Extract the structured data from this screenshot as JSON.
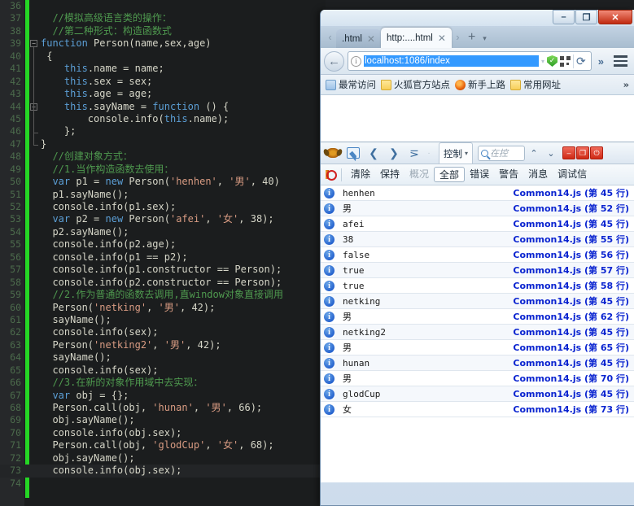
{
  "editor": {
    "first_line_number": 36,
    "lines": [
      {
        "n": 36,
        "segments": []
      },
      {
        "n": 37,
        "segments": [
          {
            "t": "  //模拟高级语言类的操作：",
            "c": "cmt"
          }
        ]
      },
      {
        "n": 38,
        "segments": [
          {
            "t": "  //第二种形式：构造函数式",
            "c": "cmt"
          }
        ]
      },
      {
        "n": 39,
        "fold": "minus",
        "segments": [
          {
            "t": "function",
            "c": "kw"
          },
          {
            "t": " Person(name,sex,age)",
            "c": ""
          }
        ]
      },
      {
        "n": 40,
        "segments": [
          {
            "t": " {",
            "c": ""
          }
        ]
      },
      {
        "n": 41,
        "segments": [
          {
            "t": "    ",
            "c": ""
          },
          {
            "t": "this",
            "c": "kw"
          },
          {
            "t": ".name = name;",
            "c": ""
          }
        ]
      },
      {
        "n": 42,
        "segments": [
          {
            "t": "    ",
            "c": ""
          },
          {
            "t": "this",
            "c": "kw"
          },
          {
            "t": ".sex = sex;",
            "c": ""
          }
        ]
      },
      {
        "n": 43,
        "segments": [
          {
            "t": "    ",
            "c": ""
          },
          {
            "t": "this",
            "c": "kw"
          },
          {
            "t": ".age = age;",
            "c": ""
          }
        ]
      },
      {
        "n": 44,
        "fold": "minus",
        "segments": [
          {
            "t": "    ",
            "c": ""
          },
          {
            "t": "this",
            "c": "kw"
          },
          {
            "t": ".sayName = ",
            "c": ""
          },
          {
            "t": "function",
            "c": "kw"
          },
          {
            "t": " () {",
            "c": ""
          }
        ]
      },
      {
        "n": 45,
        "segments": [
          {
            "t": "        console.info(",
            "c": ""
          },
          {
            "t": "this",
            "c": "kw"
          },
          {
            "t": ".name);",
            "c": ""
          }
        ]
      },
      {
        "n": 46,
        "segments": [
          {
            "t": "    };",
            "c": ""
          }
        ]
      },
      {
        "n": 47,
        "segments": [
          {
            "t": "}",
            "c": ""
          }
        ]
      },
      {
        "n": 48,
        "segments": [
          {
            "t": "  //创建对象方式：",
            "c": "cmt"
          }
        ]
      },
      {
        "n": 49,
        "segments": [
          {
            "t": "  //1.当作构造函数去使用：",
            "c": "cmt"
          }
        ]
      },
      {
        "n": 50,
        "segments": [
          {
            "t": "  ",
            "c": ""
          },
          {
            "t": "var",
            "c": "kw"
          },
          {
            "t": " p1 = ",
            "c": ""
          },
          {
            "t": "new",
            "c": "kw"
          },
          {
            "t": " Person(",
            "c": ""
          },
          {
            "t": "'henhen'",
            "c": "str"
          },
          {
            "t": ", ",
            "c": ""
          },
          {
            "t": "'男'",
            "c": "str"
          },
          {
            "t": ", 40)",
            "c": ""
          }
        ]
      },
      {
        "n": 51,
        "segments": [
          {
            "t": "  p1.sayName();",
            "c": ""
          }
        ]
      },
      {
        "n": 52,
        "segments": [
          {
            "t": "  console.info(p1.sex);",
            "c": ""
          }
        ]
      },
      {
        "n": 53,
        "segments": [
          {
            "t": "  ",
            "c": ""
          },
          {
            "t": "var",
            "c": "kw"
          },
          {
            "t": " p2 = ",
            "c": ""
          },
          {
            "t": "new",
            "c": "kw"
          },
          {
            "t": " Person(",
            "c": ""
          },
          {
            "t": "'afei'",
            "c": "str"
          },
          {
            "t": ", ",
            "c": ""
          },
          {
            "t": "'女'",
            "c": "str"
          },
          {
            "t": ", 38);",
            "c": ""
          }
        ]
      },
      {
        "n": 54,
        "segments": [
          {
            "t": "  p2.sayName();",
            "c": ""
          }
        ]
      },
      {
        "n": 55,
        "segments": [
          {
            "t": "  console.info(p2.age);",
            "c": ""
          }
        ]
      },
      {
        "n": 56,
        "segments": [
          {
            "t": "  console.info(p1 == p2);",
            "c": ""
          }
        ]
      },
      {
        "n": 57,
        "segments": [
          {
            "t": "  console.info(p1.constructor == Person);",
            "c": ""
          }
        ]
      },
      {
        "n": 58,
        "segments": [
          {
            "t": "  console.info(p2.constructor == Person);",
            "c": ""
          }
        ]
      },
      {
        "n": 59,
        "segments": [
          {
            "t": "  //2.作为普通的函数去调用,直window对象直接调用",
            "c": "cmt"
          }
        ]
      },
      {
        "n": 60,
        "segments": [
          {
            "t": "  Person(",
            "c": ""
          },
          {
            "t": "'netking'",
            "c": "str"
          },
          {
            "t": ", ",
            "c": ""
          },
          {
            "t": "'男'",
            "c": "str"
          },
          {
            "t": ", 42);",
            "c": ""
          }
        ]
      },
      {
        "n": 61,
        "segments": [
          {
            "t": "  sayName();",
            "c": ""
          }
        ]
      },
      {
        "n": 62,
        "segments": [
          {
            "t": "  console.info(sex);",
            "c": ""
          }
        ]
      },
      {
        "n": 63,
        "segments": [
          {
            "t": "  Person(",
            "c": ""
          },
          {
            "t": "'netking2'",
            "c": "str"
          },
          {
            "t": ", ",
            "c": ""
          },
          {
            "t": "'男'",
            "c": "str"
          },
          {
            "t": ", 42);",
            "c": ""
          }
        ]
      },
      {
        "n": 64,
        "segments": [
          {
            "t": "  sayName();",
            "c": ""
          }
        ]
      },
      {
        "n": 65,
        "segments": [
          {
            "t": "  console.info(sex);",
            "c": ""
          }
        ]
      },
      {
        "n": 66,
        "segments": [
          {
            "t": "  //3.在新的对象作用域中去实现：",
            "c": "cmt"
          }
        ]
      },
      {
        "n": 67,
        "segments": [
          {
            "t": "  ",
            "c": ""
          },
          {
            "t": "var",
            "c": "kw"
          },
          {
            "t": " obj = {};",
            "c": ""
          }
        ]
      },
      {
        "n": 68,
        "segments": [
          {
            "t": "  Person.call(obj, ",
            "c": ""
          },
          {
            "t": "'hunan'",
            "c": "str"
          },
          {
            "t": ", ",
            "c": ""
          },
          {
            "t": "'男'",
            "c": "str"
          },
          {
            "t": ", 66);",
            "c": ""
          }
        ]
      },
      {
        "n": 69,
        "segments": [
          {
            "t": "  obj.sayName();",
            "c": ""
          }
        ]
      },
      {
        "n": 70,
        "segments": [
          {
            "t": "  console.info(obj.sex);",
            "c": ""
          }
        ]
      },
      {
        "n": 71,
        "segments": [
          {
            "t": "  Person.call(obj, ",
            "c": ""
          },
          {
            "t": "'glodCup'",
            "c": "str"
          },
          {
            "t": ", ",
            "c": ""
          },
          {
            "t": "'女'",
            "c": "str"
          },
          {
            "t": ", 68);",
            "c": ""
          }
        ]
      },
      {
        "n": 72,
        "segments": [
          {
            "t": "  obj.sayName();",
            "c": ""
          }
        ]
      },
      {
        "n": 73,
        "current": true,
        "segments": [
          {
            "t": "  console.info(obj.sex);",
            "c": ""
          }
        ]
      },
      {
        "n": 74,
        "segments": []
      }
    ]
  },
  "browser": {
    "window_controls": {
      "minimize": "–",
      "maximize": "❐",
      "close": "✕"
    },
    "tabs": [
      {
        "label": ".html",
        "active": false,
        "close": "✕"
      },
      {
        "label": "http:....html",
        "active": true,
        "close": "✕"
      }
    ],
    "tab_scroll_left": "‹",
    "tab_scroll_right": "›",
    "new_tab": "+",
    "tab_list_menu": "▾",
    "nav": {
      "back": "←",
      "url_value": "localhost:1086/index",
      "identity_icon": "info-icon",
      "dropdown_marker": "▾",
      "reload": "⟳",
      "overflow": "»",
      "menu": "hamburger-icon"
    },
    "bookmarks": [
      {
        "label": "最常访问",
        "icon": "most-visited-icon"
      },
      {
        "label": "火狐官方站点",
        "icon": "folder-icon"
      },
      {
        "label": "新手上路",
        "icon": "firefox-icon"
      },
      {
        "label": "常用网址",
        "icon": "folder-icon"
      }
    ],
    "bookmarks_overflow": "»"
  },
  "devtools": {
    "toolbar_icons": [
      "bug-icon",
      "element-picker-icon"
    ],
    "nav_back": "❮",
    "nav_forward": "❯",
    "nav_list": "⋝",
    "separator": "·",
    "active_panel": "控制",
    "panel_caret": "▾",
    "search_placeholder": "在控",
    "scroll_up": "⌃",
    "scroll_down": "⌄",
    "window_buttons": [
      "–",
      "❐",
      "⏻"
    ],
    "filters": {
      "noentry_icon": "no-entry-icon",
      "clear": "清除",
      "persist": "保持",
      "overview": "概况",
      "all": "全部",
      "errors": "错误",
      "warnings": "警告",
      "messages": "消息",
      "debug": "调试信"
    },
    "selected_filter": "全部",
    "console_rows": [
      {
        "icon": "info-icon",
        "message": "henhen",
        "source": "Common14.js (第 45 行)",
        "cjk": false
      },
      {
        "icon": "info-icon",
        "message": "男",
        "source": "Common14.js (第 52 行)",
        "cjk": true
      },
      {
        "icon": "info-icon",
        "message": "afei",
        "source": "Common14.js (第 45 行)",
        "cjk": false
      },
      {
        "icon": "info-icon",
        "message": "38",
        "source": "Common14.js (第 55 行)",
        "cjk": false
      },
      {
        "icon": "info-icon",
        "message": "false",
        "source": "Common14.js (第 56 行)",
        "cjk": false
      },
      {
        "icon": "info-icon",
        "message": "true",
        "source": "Common14.js (第 57 行)",
        "cjk": false
      },
      {
        "icon": "info-icon",
        "message": "true",
        "source": "Common14.js (第 58 行)",
        "cjk": false
      },
      {
        "icon": "info-icon",
        "message": "netking",
        "source": "Common14.js (第 45 行)",
        "cjk": false
      },
      {
        "icon": "info-icon",
        "message": "男",
        "source": "Common14.js (第 62 行)",
        "cjk": true
      },
      {
        "icon": "info-icon",
        "message": "netking2",
        "source": "Common14.js (第 45 行)",
        "cjk": false
      },
      {
        "icon": "info-icon",
        "message": "男",
        "source": "Common14.js (第 65 行)",
        "cjk": true
      },
      {
        "icon": "info-icon",
        "message": "hunan",
        "source": "Common14.js (第 45 行)",
        "cjk": false
      },
      {
        "icon": "info-icon",
        "message": "男",
        "source": "Common14.js (第 70 行)",
        "cjk": true
      },
      {
        "icon": "info-icon",
        "message": "glodCup",
        "source": "Common14.js (第 45 行)",
        "cjk": false
      },
      {
        "icon": "info-icon",
        "message": "女",
        "source": "Common14.js (第 73 行)",
        "cjk": true
      }
    ]
  },
  "colors": {
    "editor_bg": "#1b1d1e",
    "gutter_bg": "#26282a",
    "change_bar_green": "#25d625",
    "comment_green": "#4f9a4f",
    "keyword_blue": "#5c9fd6",
    "string_salmon": "#d89b82",
    "console_source_blue": "#0a24d0",
    "url_selection_blue": "#3399ff"
  }
}
